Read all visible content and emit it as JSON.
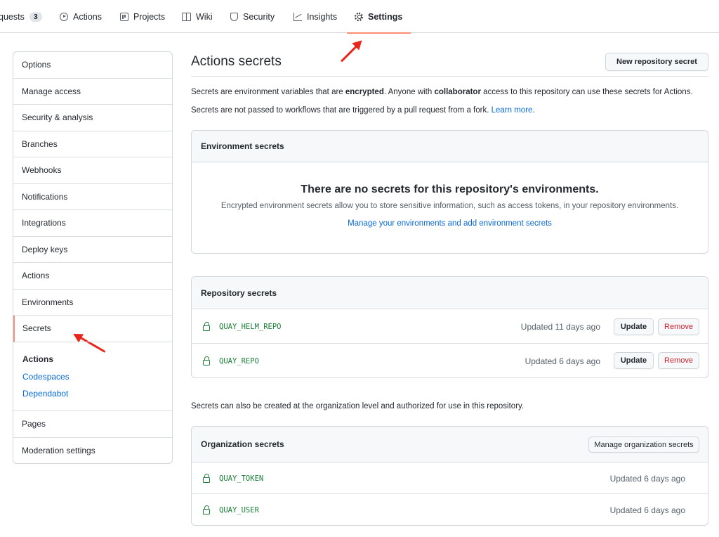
{
  "nav": {
    "tabs": [
      {
        "label": "quests",
        "count": "3",
        "icon": "pull-request-icon"
      },
      {
        "label": "Actions",
        "icon": "play-icon"
      },
      {
        "label": "Projects",
        "icon": "project-board-icon"
      },
      {
        "label": "Wiki",
        "icon": "book-icon"
      },
      {
        "label": "Security",
        "icon": "shield-icon"
      },
      {
        "label": "Insights",
        "icon": "graph-icon"
      },
      {
        "label": "Settings",
        "icon": "gear-icon",
        "active": true
      }
    ]
  },
  "sidebar": {
    "items": [
      "Options",
      "Manage access",
      "Security & analysis",
      "Branches",
      "Webhooks",
      "Notifications",
      "Integrations",
      "Deploy keys",
      "Actions",
      "Environments",
      "Secrets"
    ],
    "selected": "Secrets",
    "group_title": "Actions",
    "group_links": [
      "Codespaces",
      "Dependabot"
    ],
    "bottom_items": [
      "Pages",
      "Moderation settings"
    ]
  },
  "main": {
    "title": "Actions secrets",
    "new_button": "New repository secret",
    "intro_1": {
      "pre": "Secrets are environment variables that are ",
      "b1": "encrypted",
      "mid": ". Anyone with ",
      "b2": "collaborator",
      "post": " access to this repository can use these secrets for Actions."
    },
    "intro_2": {
      "text": "Secrets are not passed to workflows that are triggered by a pull request from a fork. ",
      "link": "Learn more",
      "end": "."
    },
    "environment": {
      "header": "Environment secrets",
      "empty_title": "There are no secrets for this repository's environments.",
      "empty_desc": "Encrypted environment secrets allow you to store sensitive information, such as access tokens, in your repository environments.",
      "empty_link": "Manage your environments and add environment secrets"
    },
    "repository": {
      "header": "Repository secrets",
      "update_label": "Update",
      "remove_label": "Remove",
      "secrets": [
        {
          "name": "QUAY_HELM_REPO",
          "updated": "Updated 11 days ago"
        },
        {
          "name": "QUAY_REPO",
          "updated": "Updated 6 days ago"
        }
      ]
    },
    "org_note": "Secrets can also be created at the organization level and authorized for use in this repository.",
    "organization": {
      "header": "Organization secrets",
      "manage_button": "Manage organization secrets",
      "secrets": [
        {
          "name": "QUAY_TOKEN",
          "updated": "Updated 6 days ago"
        },
        {
          "name": "QUAY_USER",
          "updated": "Updated 6 days ago"
        }
      ]
    }
  },
  "colors": {
    "accent_underline": "#fd8c73",
    "link": "#0969da",
    "secret_green": "#1a7f37",
    "danger": "#cf222e",
    "annotation_arrow": "#e8261c"
  }
}
